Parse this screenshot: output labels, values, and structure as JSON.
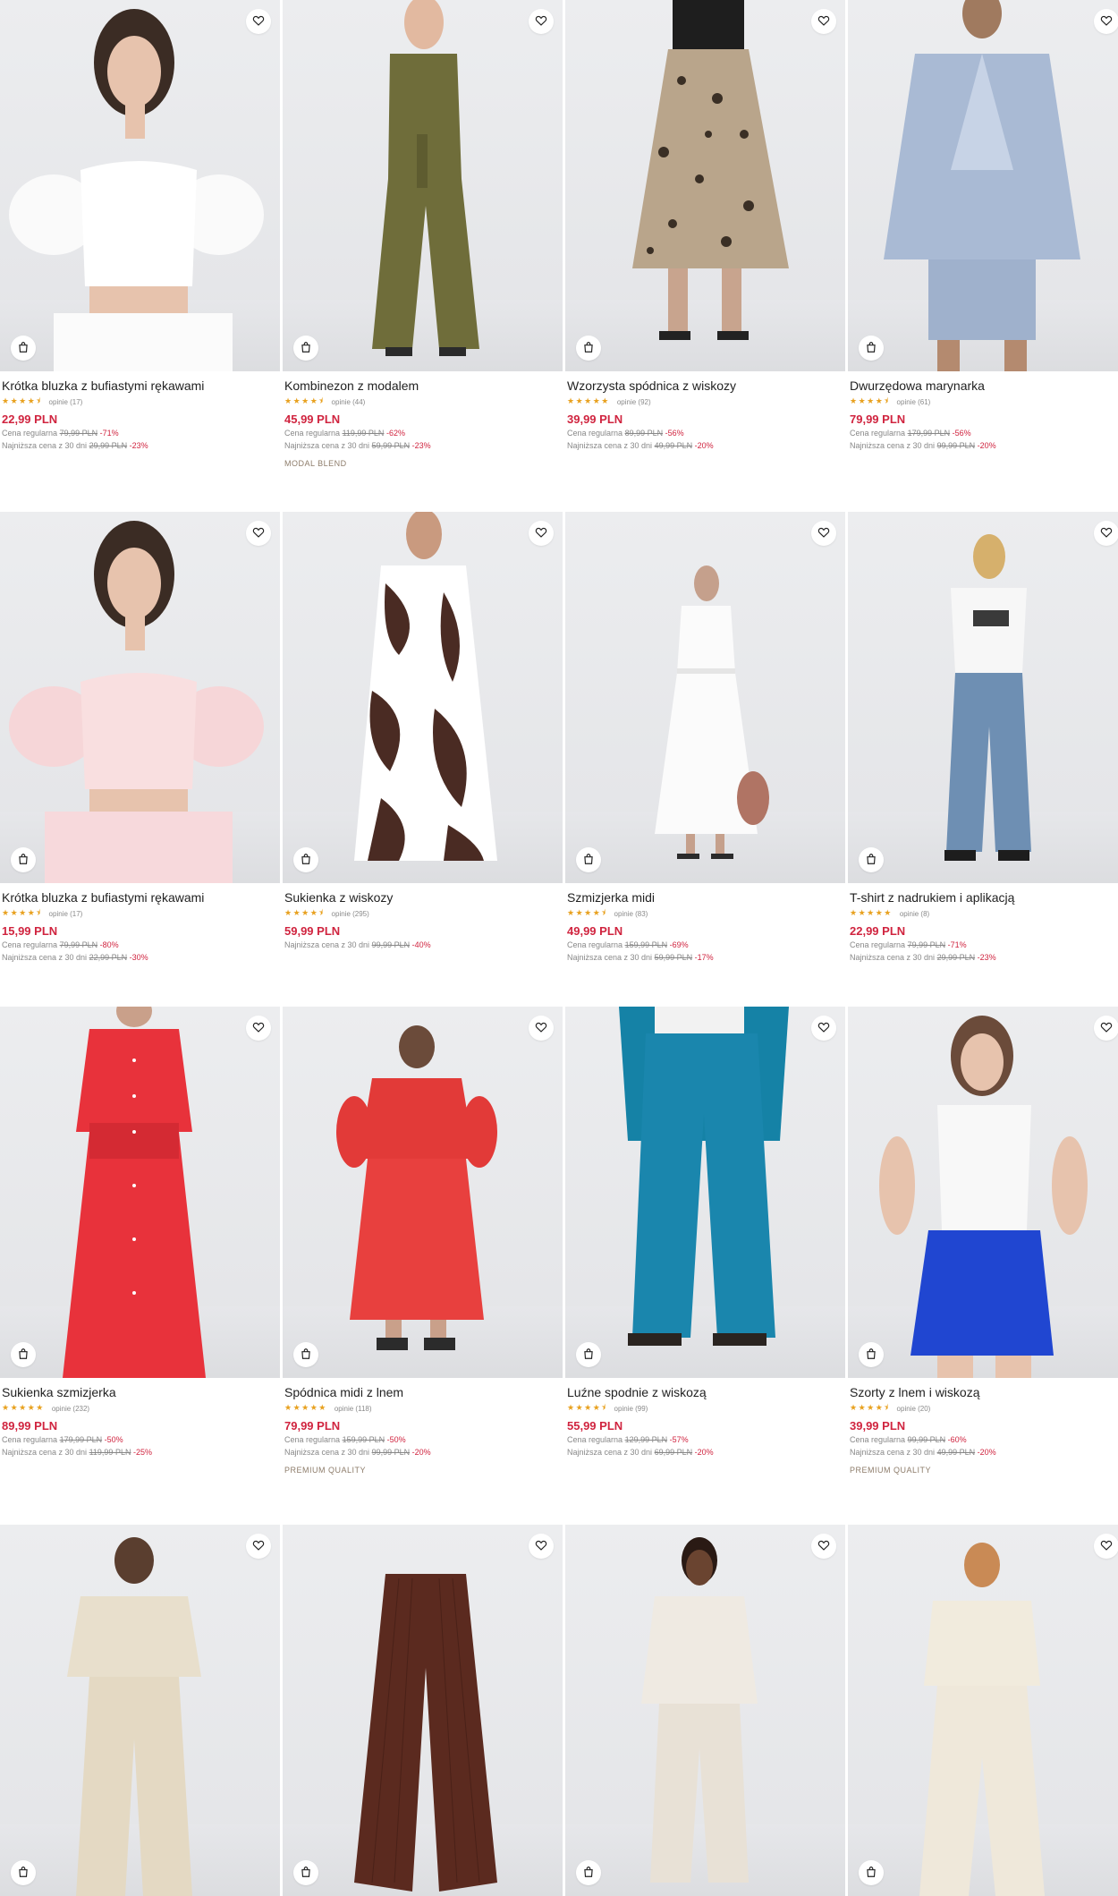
{
  "labels": {
    "regular_price": "Cena regularna",
    "lowest_price": "Najniższa cena z 30 dni"
  },
  "icons": {
    "wishlist": "heart-icon",
    "add_to_cart": "shopping-bag-icon"
  },
  "colors": {
    "price": "#d0243f",
    "stars": "#e8a11f",
    "tag": "#8d7c6a"
  },
  "products": [
    {
      "name": "Krótka bluzka z bufiastymi rękawami",
      "rating": 4.5,
      "reviews": "opinie (17)",
      "price": "22,99 PLN",
      "regular_old": "79,99 PLN",
      "regular_disc": "-71%",
      "lowest_old": "29,99 PLN",
      "lowest_disc": "-23%",
      "tag": ""
    },
    {
      "name": "Kombinezon z modalem",
      "rating": 4.5,
      "reviews": "opinie (44)",
      "price": "45,99 PLN",
      "regular_old": "119,99 PLN",
      "regular_disc": "-62%",
      "lowest_old": "59,99 PLN",
      "lowest_disc": "-23%",
      "tag": "MODAL BLEND"
    },
    {
      "name": "Wzorzysta spódnica z wiskozy",
      "rating": 5,
      "reviews": "opinie (92)",
      "price": "39,99 PLN",
      "regular_old": "89,99 PLN",
      "regular_disc": "-56%",
      "lowest_old": "49,99 PLN",
      "lowest_disc": "-20%",
      "tag": ""
    },
    {
      "name": "Dwurzędowa marynarka",
      "rating": 4.5,
      "reviews": "opinie (61)",
      "price": "79,99 PLN",
      "regular_old": "179,99 PLN",
      "regular_disc": "-56%",
      "lowest_old": "99,99 PLN",
      "lowest_disc": "-20%",
      "tag": ""
    },
    {
      "name": "Krótka bluzka z bufiastymi rękawami",
      "rating": 4.5,
      "reviews": "opinie (17)",
      "price": "15,99 PLN",
      "regular_old": "79,99 PLN",
      "regular_disc": "-80%",
      "lowest_old": "22,99 PLN",
      "lowest_disc": "-30%",
      "tag": ""
    },
    {
      "name": "Sukienka z wiskozy",
      "rating": 4.5,
      "reviews": "opinie (295)",
      "price": "59,99 PLN",
      "regular_old": "",
      "regular_disc": "",
      "lowest_old": "99,99 PLN",
      "lowest_disc": "-40%",
      "tag": ""
    },
    {
      "name": "Szmizjerka midi",
      "rating": 4.5,
      "reviews": "opinie (83)",
      "price": "49,99 PLN",
      "regular_old": "159,99 PLN",
      "regular_disc": "-69%",
      "lowest_old": "59,99 PLN",
      "lowest_disc": "-17%",
      "tag": ""
    },
    {
      "name": "T-shirt z nadrukiem i aplikacją",
      "rating": 5,
      "reviews": "opinie (8)",
      "price": "22,99 PLN",
      "regular_old": "79,99 PLN",
      "regular_disc": "-71%",
      "lowest_old": "29,99 PLN",
      "lowest_disc": "-23%",
      "tag": ""
    },
    {
      "name": "Sukienka szmizjerka",
      "rating": 5,
      "reviews": "opinie (232)",
      "price": "89,99 PLN",
      "regular_old": "179,99 PLN",
      "regular_disc": "-50%",
      "lowest_old": "119,99 PLN",
      "lowest_disc": "-25%",
      "tag": ""
    },
    {
      "name": "Spódnica midi z lnem",
      "rating": 5,
      "reviews": "opinie (118)",
      "price": "79,99 PLN",
      "regular_old": "159,99 PLN",
      "regular_disc": "-50%",
      "lowest_old": "99,99 PLN",
      "lowest_disc": "-20%",
      "tag": "PREMIUM QUALITY"
    },
    {
      "name": "Luźne spodnie z wiskozą",
      "rating": 4.5,
      "reviews": "opinie (99)",
      "price": "55,99 PLN",
      "regular_old": "129,99 PLN",
      "regular_disc": "-57%",
      "lowest_old": "69,99 PLN",
      "lowest_disc": "-20%",
      "tag": ""
    },
    {
      "name": "Szorty z lnem i wiskozą",
      "rating": 4.5,
      "reviews": "opinie (20)",
      "price": "39,99 PLN",
      "regular_old": "99,99 PLN",
      "regular_disc": "-60%",
      "lowest_old": "49,99 PLN",
      "lowest_disc": "-20%",
      "tag": "PREMIUM QUALITY"
    },
    {
      "name": "",
      "rating": 0,
      "reviews": "",
      "price": "",
      "regular_old": "",
      "regular_disc": "",
      "lowest_old": "",
      "lowest_disc": "",
      "tag": ""
    },
    {
      "name": "",
      "rating": 0,
      "reviews": "",
      "price": "",
      "regular_old": "",
      "regular_disc": "",
      "lowest_old": "",
      "lowest_disc": "",
      "tag": ""
    },
    {
      "name": "",
      "rating": 0,
      "reviews": "",
      "price": "",
      "regular_old": "",
      "regular_disc": "",
      "lowest_old": "",
      "lowest_disc": "",
      "tag": ""
    },
    {
      "name": "",
      "rating": 0,
      "reviews": "",
      "price": "",
      "regular_old": "",
      "regular_disc": "",
      "lowest_old": "",
      "lowest_disc": "",
      "tag": ""
    }
  ]
}
